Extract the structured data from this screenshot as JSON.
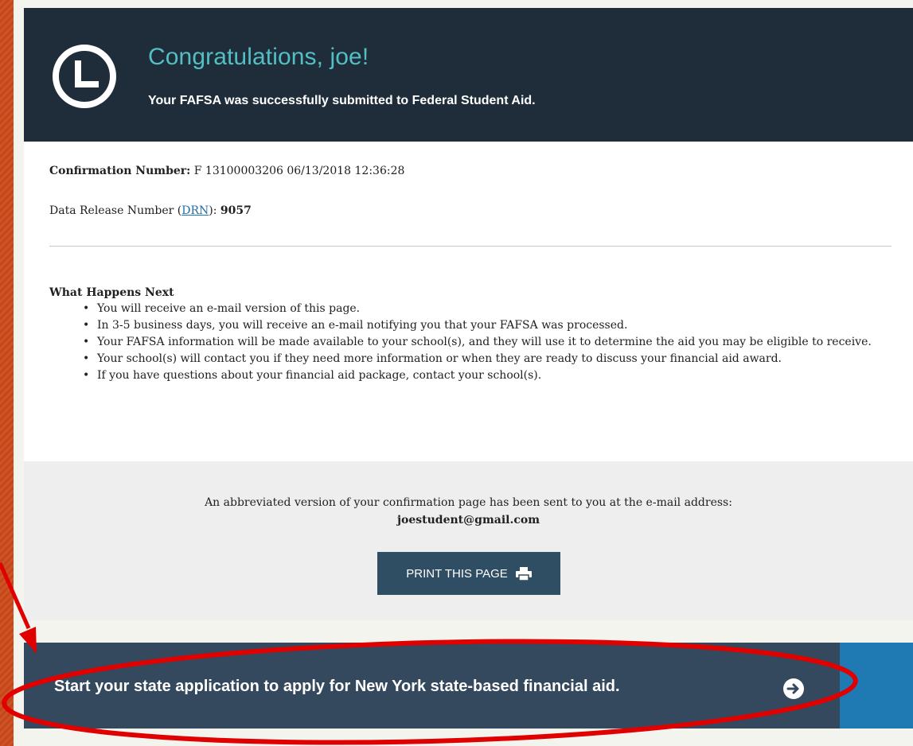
{
  "header": {
    "icon": "clock-icon",
    "title": "Congratulations, joe!",
    "subtitle": "Your FAFSA was successfully submitted to Federal Student Aid."
  },
  "confirmation": {
    "label": "Confirmation Number:",
    "value": "F 13100003206 06/13/2018 12:36:28"
  },
  "drn": {
    "label_before": "Data Release Number (",
    "link_text": "DRN",
    "label_after": "):",
    "value": "9057"
  },
  "next_steps": {
    "title": "What Happens Next",
    "items": [
      "You will receive an e-mail version of this page.",
      "In 3-5 business days, you will receive an e-mail notifying you that your FAFSA was processed.",
      "Your FAFSA information will be made available to your school(s), and they will use it to determine the aid you may be eligible to receive.",
      "Your school(s) will contact you if they need more information or when they are ready to discuss your financial aid award.",
      "If you have questions about your financial aid package, contact your school(s)."
    ]
  },
  "email_notice": {
    "text": "An abbreviated version of your confirmation page has been sent to you at the e-mail address:",
    "address": "joestudent@gmail.com"
  },
  "print_button": {
    "label": "PRINT THIS PAGE",
    "icon": "printer-icon"
  },
  "state_application": {
    "label": "Start your state application to apply for New York state-based financial aid.",
    "icon": "arrow-right-circle-icon"
  },
  "colors": {
    "banner": "#1f2d3b",
    "title_accent": "#53bfc3",
    "button": "#2f4d63",
    "state_bar": "#34495e",
    "state_accent": "#1f7ab3",
    "annotation": "#e00000",
    "slide_background": "#c8451a"
  }
}
